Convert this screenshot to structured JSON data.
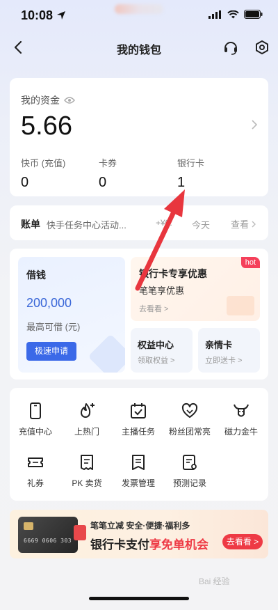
{
  "status": {
    "time": "10:08"
  },
  "nav": {
    "title": "我的钱包"
  },
  "assets": {
    "label": "我的资金",
    "value": "5.66",
    "columns": [
      {
        "label": "快币 (充值)",
        "value": "0"
      },
      {
        "label": "卡券",
        "value": "0"
      },
      {
        "label": "银行卡",
        "value": "1"
      }
    ]
  },
  "bill": {
    "title": "账单",
    "desc": "快手任务中心活动...",
    "amount": "+¥0.",
    "today": "今天",
    "view": "查看"
  },
  "loan": {
    "title": "借钱",
    "amount": "200,000",
    "sub": "最高可借 (元)",
    "button": "极速申请"
  },
  "bank_offer": {
    "title": "银行卡专享优惠",
    "sub": "笔笔享优惠",
    "link": "去看看 >",
    "badge": "hot"
  },
  "benefits": {
    "title": "权益中心",
    "sub": "领取权益 >"
  },
  "family_card": {
    "title": "亲情卡",
    "sub": "立即送卡 >"
  },
  "grid": [
    {
      "label": "充值中心",
      "icon": "phone-icon"
    },
    {
      "label": "上热门",
      "icon": "fire-plus-icon"
    },
    {
      "label": "主播任务",
      "icon": "calendar-check-icon"
    },
    {
      "label": "粉丝团常亮",
      "icon": "heart-badge-icon"
    },
    {
      "label": "磁力金牛",
      "icon": "bull-icon"
    },
    {
      "label": "礼券",
      "icon": "ticket-icon"
    },
    {
      "label": "PK 卖货",
      "icon": "receipt-icon"
    },
    {
      "label": "发票管理",
      "icon": "invoice-icon"
    },
    {
      "label": "预测记录",
      "icon": "record-icon"
    }
  ],
  "banner": {
    "small": "笔笔立减  安全·便捷·福利多",
    "big_prefix": "银行卡支付",
    "big_highlight": "享免单机会",
    "button": "去看看 >",
    "card_number": "6669 0606 303"
  },
  "watermark": "Bai 经验"
}
